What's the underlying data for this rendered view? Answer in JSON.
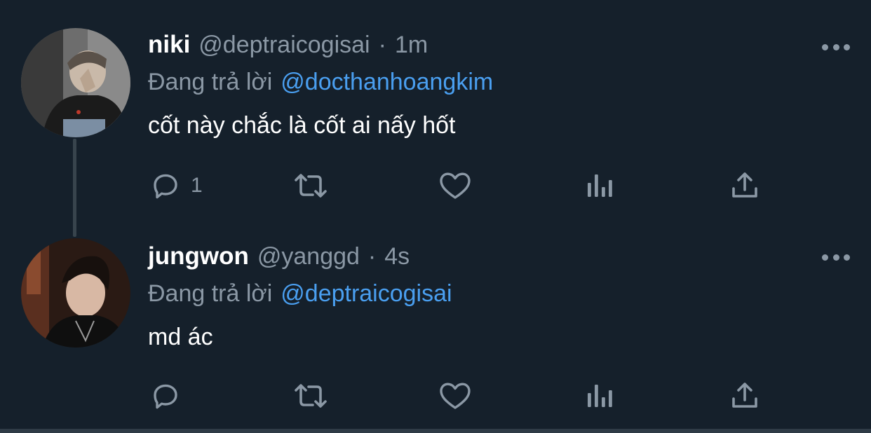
{
  "tweets": [
    {
      "display_name": "niki",
      "handle": "@deptraicogisai",
      "separator": "·",
      "time": "1m",
      "reply_prefix": "Đang trả lời",
      "reply_mention": "@docthanhoangkim",
      "text": "cốt này chắc là cốt ai nấy hốt",
      "reply_count": "1",
      "avatar": "profile-photo-icon"
    },
    {
      "display_name": "jungwon",
      "handle": "@yanggd",
      "separator": "·",
      "time": "4s",
      "reply_prefix": "Đang trả lời",
      "reply_mention": "@deptraicogisai",
      "text": "md ác",
      "reply_count": "",
      "avatar": "profile-photo-icon"
    }
  ],
  "colors": {
    "background": "#15202b",
    "text_primary": "#ffffff",
    "text_secondary": "#8b98a5",
    "link": "#4a9ff0",
    "thread_line": "#38444d"
  },
  "icons": [
    "reply-icon",
    "retweet-icon",
    "like-icon",
    "views-icon",
    "share-icon",
    "more-icon"
  ]
}
